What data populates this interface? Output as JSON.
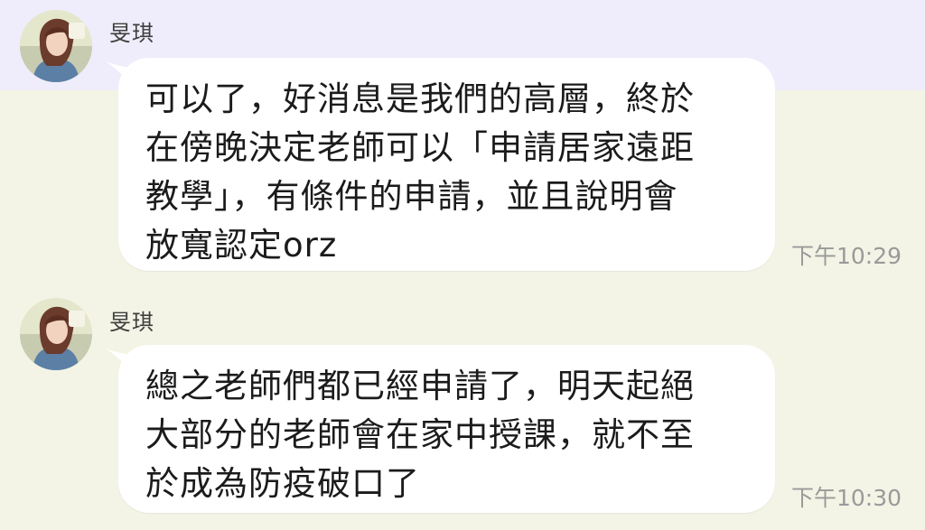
{
  "chat": {
    "messages": [
      {
        "sender": "旻琪",
        "lines": [
          "可以了，好消息是我們的高層，終於",
          "在傍晚決定老師可以「申請居家遠距",
          "教學」，有條件的申請，並且說明會",
          "放寬認定orz"
        ],
        "time": "下午10:29"
      },
      {
        "sender": "旻琪",
        "lines": [
          "總之老師們都已經申請了，明天起絕",
          "大部分的老師會在家中授課，就不至",
          "於成為防疫破口了"
        ],
        "time": "下午10:30"
      }
    ]
  },
  "colors": {
    "top_band": "#efedfb",
    "background": "#f3f4e5",
    "bubble": "#ffffff",
    "text": "#1b1b1b",
    "time": "#9a9a9a"
  },
  "icons": {
    "avatar": "user-photo"
  }
}
